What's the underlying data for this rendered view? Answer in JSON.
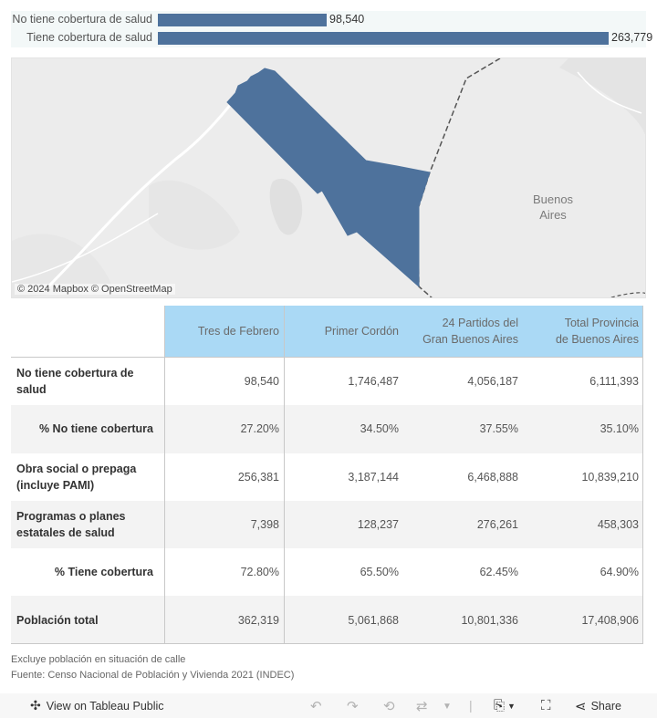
{
  "chart_data": {
    "type": "bar",
    "orientation": "horizontal",
    "categories": [
      "No tiene cobertura de salud",
      "Tiene cobertura de salud"
    ],
    "values": [
      98540,
      263779
    ],
    "value_labels": [
      "98,540",
      "263,779"
    ],
    "xlim": [
      0,
      275000
    ],
    "colors": {
      "bar": "#4e729c",
      "background": "#f3f8f8"
    }
  },
  "map": {
    "place_label": "Buenos Aires",
    "attribution_mapbox": "© 2024 Mapbox",
    "attribution_osm": "© OpenStreetMap",
    "colors": {
      "region": "#4e729c",
      "land": "#ececec"
    }
  },
  "table": {
    "columns": [
      "Tres de Febrero",
      "Primer Cordón",
      "24 Partidos del Gran Buenos Aires",
      "Total Provincia de Buenos Aires"
    ],
    "rows": [
      {
        "label": "No tiene cobertura de salud",
        "values": [
          "98,540",
          "1,746,487",
          "4,056,187",
          "6,111,393"
        ]
      },
      {
        "label": "% No tiene cobertura",
        "values": [
          "27.20%",
          "34.50%",
          "37.55%",
          "35.10%"
        ]
      },
      {
        "label": "Obra social o prepaga (incluye PAMI)",
        "values": [
          "256,381",
          "3,187,144",
          "6,468,888",
          "10,839,210"
        ]
      },
      {
        "label": "Programas o planes estatales de salud",
        "values": [
          "7,398",
          "128,237",
          "276,261",
          "458,303"
        ]
      },
      {
        "label": "% Tiene cobertura",
        "values": [
          "72.80%",
          "65.50%",
          "62.45%",
          "64.90%"
        ]
      },
      {
        "label": "Población total",
        "values": [
          "362,319",
          "5,061,868",
          "10,801,336",
          "17,408,906"
        ]
      }
    ],
    "colors": {
      "header": "#aad9f5",
      "alt_row": "#f3f3f3"
    }
  },
  "notes": {
    "line1": "Excluye población en situación de calle",
    "line2": "Fuente: Censo Nacional de Población y Vivienda 2021 (INDEC)"
  },
  "toolbar": {
    "view_label": "View on Tableau Public",
    "share_label": "Share",
    "icons": [
      "tableau-icon",
      "undo-icon",
      "redo-icon",
      "revert-icon",
      "refresh-icon",
      "dropdown-icon",
      "download-icon",
      "fullscreen-icon",
      "share-icon"
    ]
  }
}
